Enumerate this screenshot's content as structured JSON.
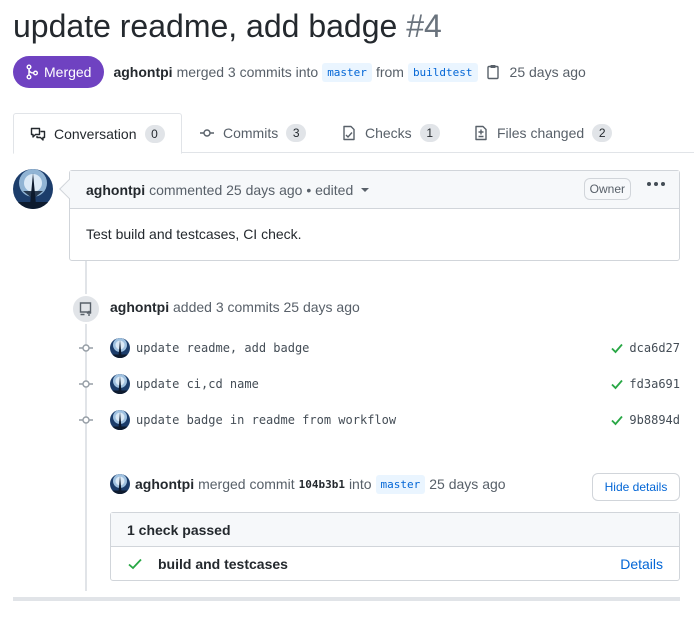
{
  "pr": {
    "title": "update readme, add badge",
    "number": "#4",
    "state": "Merged",
    "author": "aghontpi",
    "merge_text": "merged 3 commits into",
    "base_branch": "master",
    "from_text": "from",
    "head_branch": "buildtest",
    "time": "25 days ago"
  },
  "tabs": [
    {
      "label": "Conversation",
      "count": "0",
      "icon": "conversation-icon"
    },
    {
      "label": "Commits",
      "count": "3",
      "icon": "commit-icon"
    },
    {
      "label": "Checks",
      "count": "1",
      "icon": "checklist-icon"
    },
    {
      "label": "Files changed",
      "count": "2",
      "icon": "file-diff-icon"
    }
  ],
  "comment": {
    "author": "aghontpi",
    "meta": "commented 25 days ago • edited",
    "role": "Owner",
    "body": "Test build and testcases, CI check."
  },
  "push_event": {
    "author": "aghontpi",
    "text": "added 3 commits 25 days ago"
  },
  "commits": [
    {
      "message": "update readme, add badge",
      "sha": "dca6d27",
      "status": "success"
    },
    {
      "message": "update ci,cd name",
      "sha": "fd3a691",
      "status": "success"
    },
    {
      "message": "update badge in readme from workflow",
      "sha": "9b8894d",
      "status": "success"
    }
  ],
  "merge_event": {
    "author": "aghontpi",
    "text1": "merged commit",
    "sha": "104b3b1",
    "text2": "into",
    "branch": "master",
    "time": "25 days ago",
    "button": "Hide details"
  },
  "checks": {
    "summary": "1 check passed",
    "items": [
      {
        "name": "build and testcases",
        "link": "Details",
        "status": "success"
      }
    ]
  },
  "colors": {
    "merged": "#6f42c1",
    "success": "#28a745",
    "link": "#0366d6"
  }
}
